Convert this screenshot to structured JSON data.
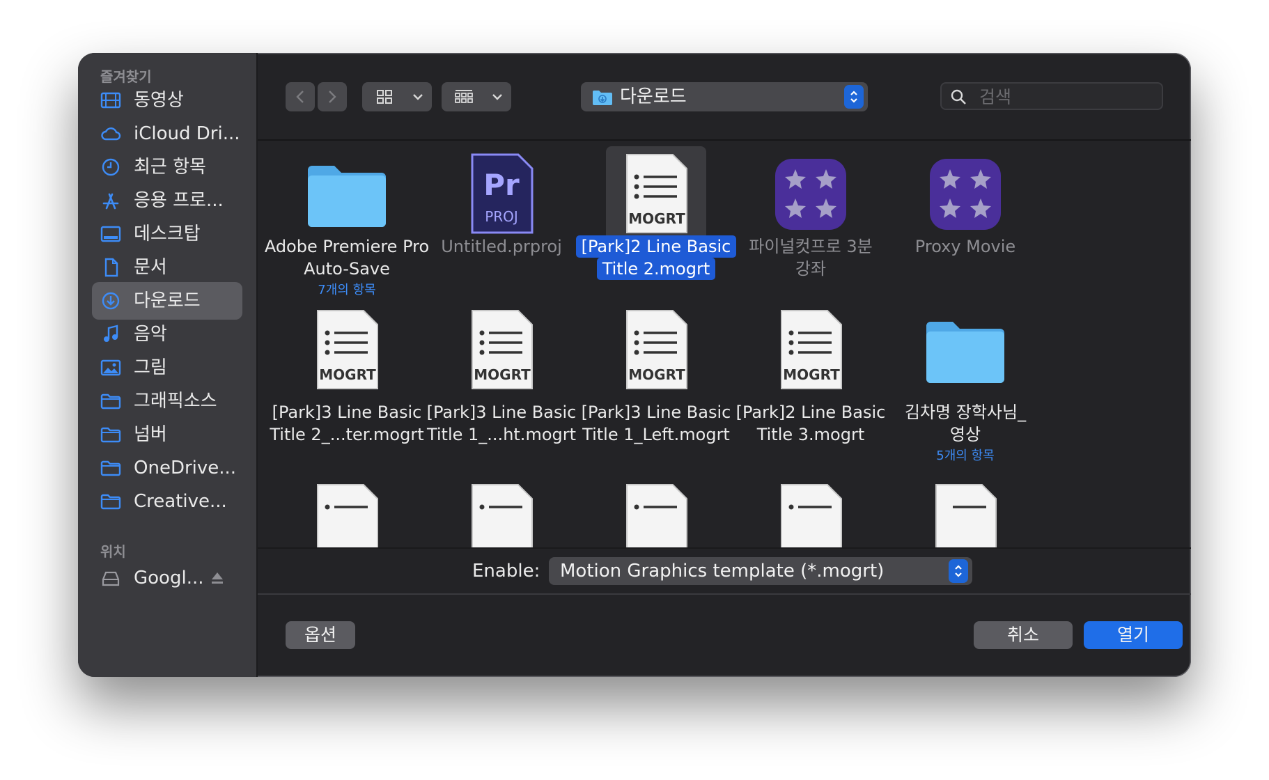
{
  "sidebar": {
    "favorites_heading": "즐겨찾기",
    "items": [
      {
        "label": "동영상",
        "icon": "film-icon"
      },
      {
        "label": "iCloud Dri...",
        "icon": "cloud-icon"
      },
      {
        "label": "최근 항목",
        "icon": "clock-icon"
      },
      {
        "label": "응용 프로...",
        "icon": "applications-icon"
      },
      {
        "label": "데스크탑",
        "icon": "desktop-icon"
      },
      {
        "label": "문서",
        "icon": "document-icon"
      },
      {
        "label": "다운로드",
        "icon": "download-icon",
        "selected": true
      },
      {
        "label": "음악",
        "icon": "music-icon"
      },
      {
        "label": "그림",
        "icon": "photo-icon"
      },
      {
        "label": "그래픽소스",
        "icon": "folder-icon"
      },
      {
        "label": "넘버",
        "icon": "folder-icon"
      },
      {
        "label": "OneDrive...",
        "icon": "folder-icon"
      },
      {
        "label": "Creative...",
        "icon": "folder-icon"
      }
    ],
    "locations_heading": "위치",
    "locations": [
      {
        "label": "Googl...",
        "icon": "drive-icon",
        "eject": "eject-icon"
      }
    ]
  },
  "toolbar": {
    "back_icon": "chevron-left-icon",
    "forward_icon": "chevron-right-icon",
    "view_icon": "grid-view-icon",
    "group_icon": "group-view-icon",
    "path": "다운로드",
    "search_placeholder": "검색"
  },
  "files": [
    {
      "name": "Adobe Premiere Pro Auto-Save",
      "sub": "7개의 항목",
      "type": "folder"
    },
    {
      "name": "Untitled.prproj",
      "type": "prproj",
      "dim": true,
      "badge_top": "Pr",
      "badge_bottom": "PROJ"
    },
    {
      "name": "[Park]2 Line Basic Title 2.mogrt",
      "type": "mogrt",
      "selected": true,
      "badge": "MOGRT"
    },
    {
      "name": "파이널컷프로 3분강좌",
      "type": "fcp",
      "dim": true
    },
    {
      "name": "Proxy Movie",
      "type": "fcp",
      "dim": true
    },
    {
      "name": "[Park]3 Line Basic Title 2_...ter.mogrt",
      "type": "mogrt",
      "badge": "MOGRT"
    },
    {
      "name": "[Park]3 Line Basic Title 1_...ht.mogrt",
      "type": "mogrt",
      "badge": "MOGRT"
    },
    {
      "name": "[Park]3 Line Basic Title 1_Left.mogrt",
      "type": "mogrt",
      "badge": "MOGRT"
    },
    {
      "name": "[Park]2 Line Basic Title 3.mogrt",
      "type": "mogrt",
      "badge": "MOGRT"
    },
    {
      "name": "김차명 장학사님_영상",
      "sub": "5개의 항목",
      "type": "folder"
    }
  ],
  "enable": {
    "label": "Enable:",
    "value": "Motion Graphics template (*.mogrt)"
  },
  "buttons": {
    "options": "옵션",
    "cancel": "취소",
    "open": "열기"
  },
  "colors": {
    "accent": "#1f6ee8",
    "folder": "#62bdf5",
    "link": "#3d8cf7"
  }
}
